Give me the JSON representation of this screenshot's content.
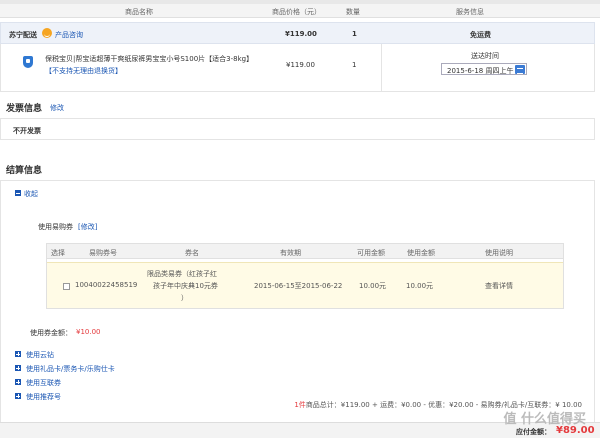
{
  "header": {
    "col_name": "商品名称",
    "col_price": "商品价格（元）",
    "col_qty": "数量",
    "col_service": "服务信息"
  },
  "store": {
    "name": "苏宁配送",
    "consult": "产品咨询",
    "price": "¥119.00",
    "qty": "1",
    "shipping": "免运费"
  },
  "item": {
    "title": "保税宝贝|帮宝适超薄干爽纸尿裤男宝宝小号S100片【适合3-8kg】",
    "notice": "【不支持无理由退换货】",
    "price": "¥119.00",
    "qty": "1",
    "delivery_label": "送达时间",
    "delivery_date": "2015-6-18 周四上午"
  },
  "invoice": {
    "title": "发票信息",
    "edit": "修改",
    "value": "不开发票"
  },
  "settlement": {
    "title": "结算信息",
    "collapse": "收起",
    "use_coupon": "使用易购券",
    "coupon_edit": "[修改]",
    "coupon_table": {
      "headers": [
        "选择",
        "易购券号",
        "券名",
        "有效期",
        "可用金额",
        "使用金额",
        "使用说明"
      ],
      "row": {
        "code": "10040022458519",
        "name_line1": "限品类易券（红孩子红",
        "name_line2": "孩子年中庆典10元券",
        "name_line3": "）",
        "validity": "2015-06-15至2015-06-22",
        "available": "10.00元",
        "used": "10.00元",
        "details": "查看详情"
      }
    },
    "coupon_total_label": "使用券金额：",
    "coupon_total_value": "¥10.00",
    "options": [
      "使用云钻",
      "使用礼品卡/票务卡/乐购仕卡",
      "使用互联券",
      "使用推荐号"
    ],
    "summary": {
      "count": "1件",
      "text": "商品总计：¥119.00 + 运费：¥0.00 - 优惠：¥20.00 - 易购券/礼品卡/互联券：¥ 10.00"
    },
    "pay_label": "应付金额：",
    "pay_value": "¥89.00"
  },
  "watermark": "值 什么值得买",
  "colors": {
    "accent": "#1a56b3",
    "price_red": "#e4393c",
    "highlight_row": "#fffbe6"
  }
}
